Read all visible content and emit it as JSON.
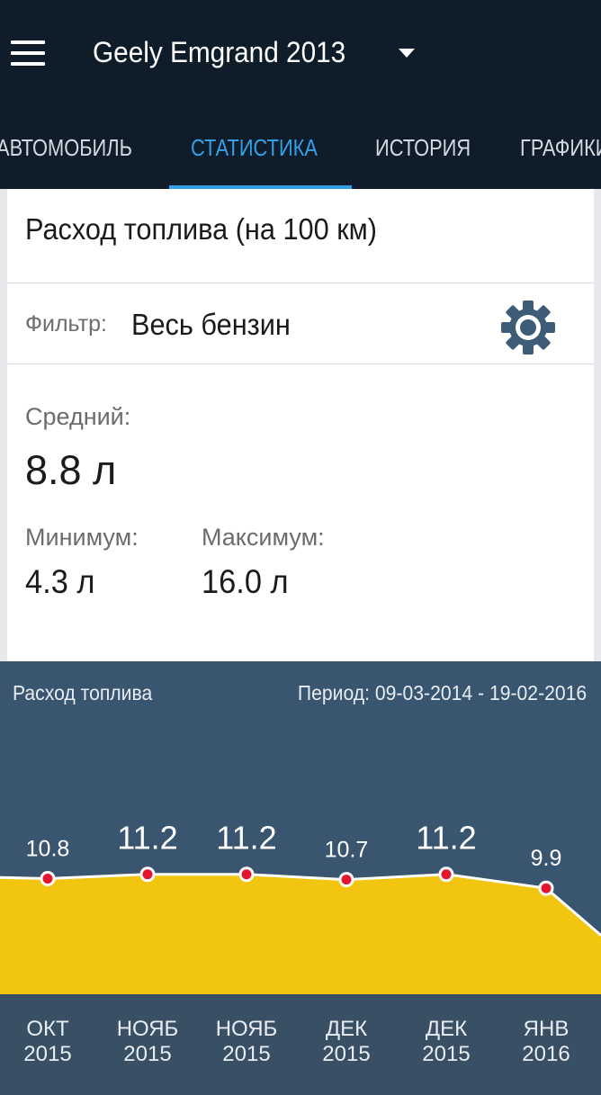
{
  "header": {
    "title": "Geely Emgrand 2013",
    "menu_icon": "hamburger-menu-icon",
    "dropdown_icon": "dropdown-arrow-icon"
  },
  "tabs": [
    {
      "label": "АВТОМОБИЛЬ",
      "active": false
    },
    {
      "label": "СТАТИСТИКА",
      "active": true
    },
    {
      "label": "ИСТОРИЯ",
      "active": false
    },
    {
      "label": "ГРАФИКИ",
      "active": false
    }
  ],
  "stats_card": {
    "title": "Расход топлива (на 100 км)",
    "filter_label": "Фильтр:",
    "filter_value": "Весь бензин",
    "settings_icon": "gear-icon",
    "average_label": "Средний:",
    "average_value": "8.8 л",
    "minimum_label": "Минимум:",
    "minimum_value": "4.3 л",
    "maximum_label": "Максимум:",
    "maximum_value": "16.0 л"
  },
  "chart_panel": {
    "title": "Расход топлива",
    "period": "Период: 09-03-2014 - 19-02-2016"
  },
  "colors": {
    "appbar": "#0f1d2b",
    "tab_active": "#33a0e6",
    "chart_bg": "#3a556f",
    "area_fill": "#f2c511",
    "point": "#e3152f"
  },
  "chart_data": {
    "type": "area",
    "title": "Расход топлива",
    "categories": [
      {
        "month": "ОКТ",
        "year": "2015"
      },
      {
        "month": "НОЯБ",
        "year": "2015"
      },
      {
        "month": "НОЯБ",
        "year": "2015"
      },
      {
        "month": "ДЕК",
        "year": "2015"
      },
      {
        "month": "ДЕК",
        "year": "2015"
      },
      {
        "month": "ЯНВ",
        "year": "2016"
      }
    ],
    "values": [
      10.8,
      11.2,
      11.2,
      10.7,
      11.2,
      9.9
    ],
    "labels": [
      "10.8",
      "11.2",
      "11.2",
      "10.7",
      "11.2",
      "9.9"
    ],
    "edge_values": {
      "left": 10.9,
      "right": 5.5
    },
    "ylim": [
      0,
      12.5
    ],
    "grid": false,
    "legend": "none"
  }
}
